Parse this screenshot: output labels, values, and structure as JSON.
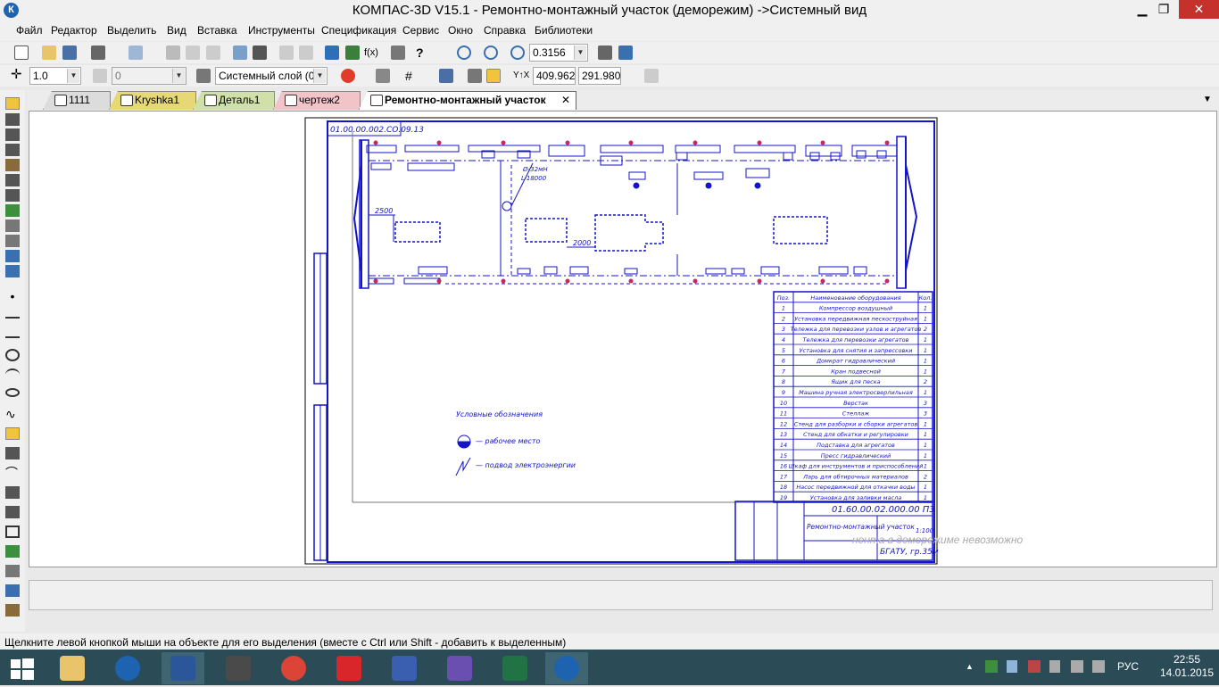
{
  "window": {
    "title": "КОМПАС-3D V15.1 - Ремонтно-монтажный участок (деморежим) ->Системный вид",
    "logo": "К",
    "minimize": "▁",
    "restore": "❐",
    "close": "✕"
  },
  "menu": [
    "Файл",
    "Редактор",
    "Выделить",
    "Вид",
    "Вставка",
    "Инструменты",
    "Спецификация",
    "Сервис",
    "Окно",
    "Справка",
    "Библиотеки"
  ],
  "toolbar1": {
    "zoom": "0.3156"
  },
  "toolbar2": {
    "step": "1.0",
    "angle": "0",
    "layer": "Системный слой (0)",
    "x": "409.962",
    "y": "291.980"
  },
  "tabs": [
    {
      "label": "1111",
      "color": "#dcdcdc"
    },
    {
      "label": "Kryshka1",
      "color": "#e6d874"
    },
    {
      "label": "Деталь1",
      "color": "#cfe0a8"
    },
    {
      "label": "чертеж2",
      "color": "#f2c3c9"
    },
    {
      "label": "Ремонтно-монтажный участок",
      "color": "#ffffff",
      "active": true,
      "close": "✕"
    }
  ],
  "drawing": {
    "stamp_top": "01.00.00.002.СО.09.13",
    "dim_2500": "2500",
    "dim_2000": "2000",
    "label_power": "Ø-32мН",
    "label_len": "L-18000",
    "legend_title": "Условные обозначения",
    "legend_work": "— рабочее место",
    "legend_power": "— подвод электроэнергии",
    "spec_head": [
      "Поз.",
      "Наименование оборудования",
      "Кол."
    ],
    "spec_rows": [
      [
        "1",
        "Компрессор воздушный",
        "1"
      ],
      [
        "2",
        "Установка передвижная пескоструйная",
        "1"
      ],
      [
        "3",
        "Тележка для перевозки узлов и агрегатов",
        "2"
      ],
      [
        "4",
        "Тележка для перевозки агрегатов",
        "1"
      ],
      [
        "5",
        "Установка для снятия и запрессовки",
        "1"
      ],
      [
        "6",
        "Домкрат гидравлический",
        "1"
      ],
      [
        "7",
        "Кран подвесной",
        "1"
      ],
      [
        "8",
        "Ящик для песка",
        "2"
      ],
      [
        "9",
        "Машина ручная электросверлильная",
        "1"
      ],
      [
        "10",
        "Верстак",
        "3"
      ],
      [
        "11",
        "Стеллаж",
        "3"
      ],
      [
        "12",
        "Стенд для разборки и сборки агрегатов",
        "1"
      ],
      [
        "13",
        "Стенд для обкатки и регулировки",
        "1"
      ],
      [
        "14",
        "Подставка для агрегатов",
        "1"
      ],
      [
        "15",
        "Пресс гидравлический",
        "1"
      ],
      [
        "16",
        "Шкаф для инструментов и приспособлений",
        "1"
      ],
      [
        "17",
        "Ларь для обтирочных материалов",
        "2"
      ],
      [
        "18",
        "Насос передвижной для откачки воды",
        "1"
      ],
      [
        "19",
        "Установка для заливки масла",
        "1"
      ]
    ],
    "stamp_code": "01.60.00.02.000.00 ПЗ",
    "stamp_name": "Ремонтно-монтажный участок",
    "stamp_scale": "1:100",
    "stamp_org": "БГАТУ, гр.35м"
  },
  "demo_notice": "нента в деморежиме невозможно",
  "status": "Щелкните левой кнопкой мыши на объекте для его выделения (вместе с Ctrl или Shift - добавить к выделенным)",
  "taskbar": {
    "lang": "РУС",
    "time": "22:55",
    "date": "14.01.2015"
  }
}
